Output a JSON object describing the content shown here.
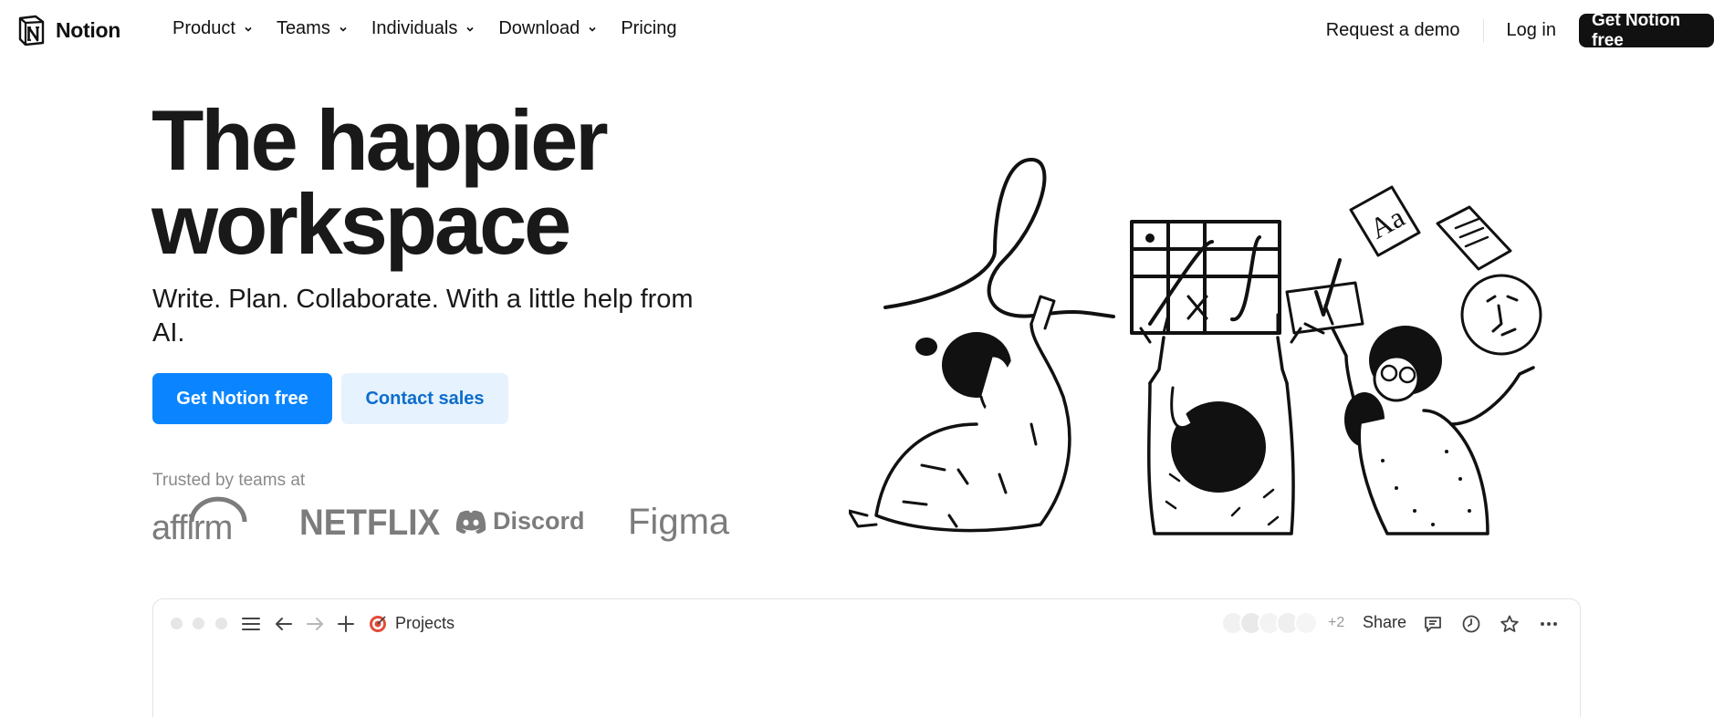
{
  "brand": {
    "name": "Notion"
  },
  "nav": {
    "items": [
      {
        "label": "Product",
        "has_dropdown": true
      },
      {
        "label": "Teams",
        "has_dropdown": true
      },
      {
        "label": "Individuals",
        "has_dropdown": true
      },
      {
        "label": "Download",
        "has_dropdown": true
      },
      {
        "label": "Pricing",
        "has_dropdown": false
      }
    ],
    "request_demo": "Request a demo",
    "login": "Log in",
    "cta": "Get Notion free"
  },
  "hero": {
    "title_line1": "The happier",
    "title_line2": "workspace",
    "subtitle": "Write. Plan. Collaborate. With a little help from AI.",
    "primary_button": "Get Notion free",
    "secondary_button": "Contact sales",
    "trusted_label": "Trusted by teams at",
    "logos": [
      "affirm",
      "NETFLIX",
      "Discord",
      "Figma"
    ]
  },
  "app_window": {
    "page_title": "Projects",
    "extra_collaborators": "+2",
    "share_label": "Share",
    "icons": [
      "menu-icon",
      "back-arrow-icon",
      "forward-arrow-icon",
      "plus-icon",
      "target-icon",
      "comment-icon",
      "clock-icon",
      "star-icon",
      "more-icon"
    ]
  },
  "colors": {
    "primary": "#0a85ff",
    "secondary_bg": "#e6f2fe",
    "secondary_text": "#0c6dcc",
    "nav_cta_bg": "#111111",
    "logo_gray": "#7c7c7c"
  }
}
